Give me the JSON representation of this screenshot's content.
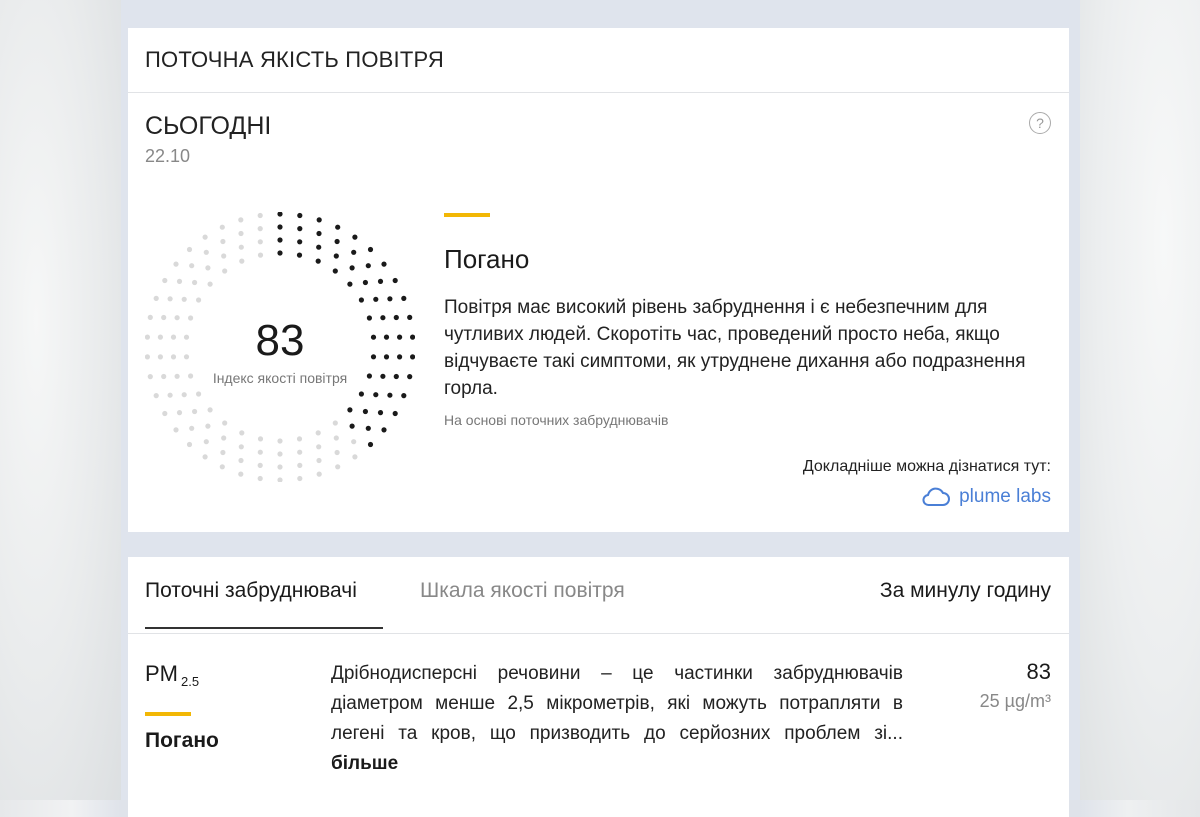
{
  "header": {
    "title": "ПОТОЧНА ЯКІСТЬ ПОВІТРЯ"
  },
  "today": {
    "title": "СЬОГОДНІ",
    "date": "22.10",
    "help_glyph": "?"
  },
  "aqi": {
    "value": "83",
    "label": "Індекс якості повітря",
    "fraction": 0.39,
    "colors": {
      "active": "#1a1a1a",
      "inactive": "#d9d9d9",
      "accent": "#f2b705"
    }
  },
  "status": {
    "title": "Погано",
    "description": "Повітря має високий рівень забруднення і є небезпечним для чутливих людей. Скоротіть час, проведений просто неба, якщо відчуваєте такі симптоми, як утруднене дихання або подразнення горла.",
    "note": "На основі поточних забруднювачів"
  },
  "more": {
    "label": "Докладніше можна дізнатися тут:",
    "brand": "plume labs",
    "brand_color": "#4a7fd6",
    "brand_icon": "cloud-icon"
  },
  "tabs": {
    "items": [
      {
        "label": "Поточні забруднювачі"
      },
      {
        "label": "Шкала якості повітря"
      }
    ],
    "period": "За минулу годину"
  },
  "pollutant": {
    "name": "PM",
    "subscript": "2.5",
    "status": "Погано",
    "description": "Дрібнодисперсні речовини – це частинки забруднювачів діаметром менше 2,5 мікрометрів, які можуть потрапляти в легені та кров, що призводить до серйозних проблем зі...",
    "more": "більше",
    "value": "83",
    "concentration": "25 µg/m³"
  }
}
